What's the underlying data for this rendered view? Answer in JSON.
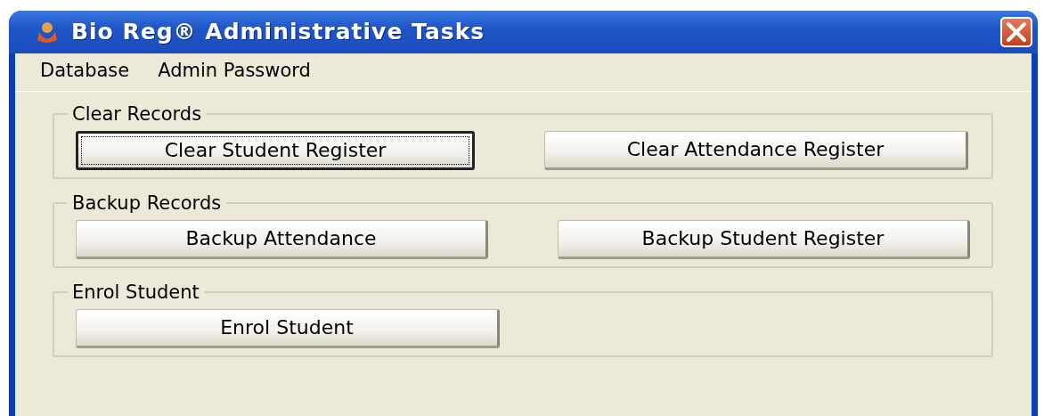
{
  "window": {
    "title": "Bio Reg® Administrative Tasks"
  },
  "menu": [
    {
      "label": "Database"
    },
    {
      "label": "Admin Password"
    }
  ],
  "groups": [
    {
      "title": "Clear Records",
      "buttons": [
        {
          "label": "Clear Student Register",
          "focused": true
        },
        {
          "label": "Clear Attendance Register",
          "focused": false
        }
      ]
    },
    {
      "title": "Backup Records",
      "buttons": [
        {
          "label": "Backup Attendance",
          "focused": false
        },
        {
          "label": "Backup Student Register",
          "focused": false
        }
      ]
    },
    {
      "title": "Enrol Student",
      "buttons": [
        {
          "label": "Enrol Student",
          "focused": false
        }
      ]
    }
  ]
}
